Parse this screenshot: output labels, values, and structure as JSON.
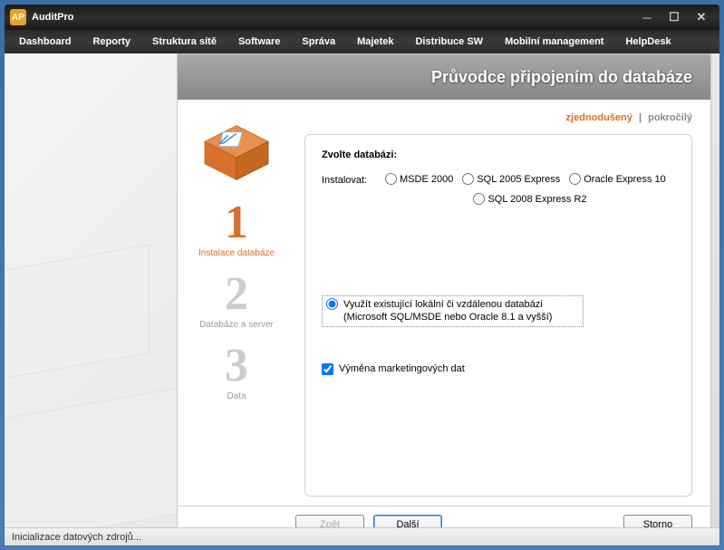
{
  "window": {
    "title": "AuditPro",
    "app_icon_text": "AP"
  },
  "menubar": {
    "items": [
      "Dashboard",
      "Reporty",
      "Struktura sítě",
      "Software",
      "Správa",
      "Majetek",
      "Distribuce SW",
      "Mobilní management",
      "HelpDesk"
    ]
  },
  "wizard": {
    "title": "Průvodce připojením do databáze",
    "mode": {
      "simple": "zjednodušený",
      "advanced": "pokročilý"
    },
    "steps": [
      {
        "num": "1",
        "label": "Instalace databáze"
      },
      {
        "num": "2",
        "label": "Databáze a server"
      },
      {
        "num": "3",
        "label": "Data"
      }
    ],
    "panel": {
      "choose_label": "Zvolte databázi:",
      "install_label": "Instalovat:",
      "install_options": [
        "MSDE 2000",
        "SQL 2005 Express",
        "Oracle Express 10",
        "SQL 2008 Express R2"
      ],
      "existing_label": "Využít existující lokální či vzdálenou databázi (Microsoft SQL/MSDE nebo Oracle 8.1 a vyšší)",
      "checkbox_label": "Výměna marketingových dat"
    },
    "buttons": {
      "back": "Zpět",
      "next": "Další",
      "cancel": "Storno"
    }
  },
  "statusbar": {
    "text": "Inicializace datových zdrojů..."
  }
}
